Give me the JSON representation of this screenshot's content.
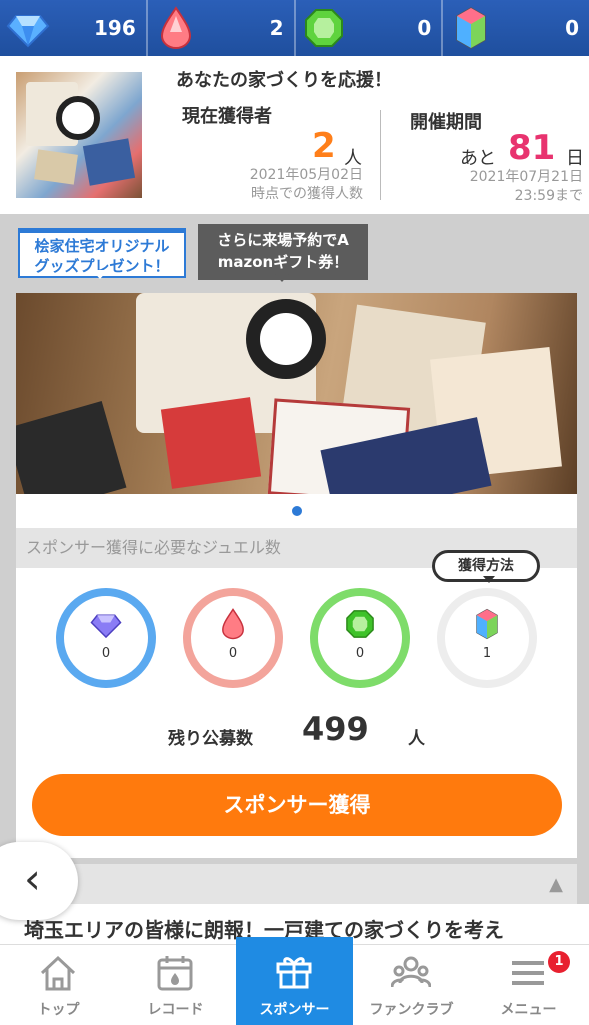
{
  "jewel_bar": {
    "items": [
      {
        "icon": "diamond-icon",
        "count": "196"
      },
      {
        "icon": "ruby-drop-icon",
        "count": "2"
      },
      {
        "icon": "emerald-icon",
        "count": "0"
      },
      {
        "icon": "rainbow-gem-icon",
        "count": "0"
      }
    ]
  },
  "header": {
    "title": "あなたの家づくりを応援！",
    "current_label": "現在獲得者",
    "current_count": "2",
    "current_unit": "人",
    "current_note_line1": "2021年05月02日",
    "current_note_line2": "時点での獲得人数",
    "period_label": "開催期間",
    "remaining_prefix": "あと",
    "remaining_days": "81",
    "remaining_unit": "日",
    "period_end_line1": "2021年07月21日",
    "period_end_line2": "23:59まで"
  },
  "campaign": {
    "tag1_line1": "桧家住宅オリジナル",
    "tag1_line2": "グッズプレゼント！",
    "tag2_line1": "さらに来場予約でA",
    "tag2_line2": "mazonギフト券！"
  },
  "jewel_requirements": {
    "heading": "スポンサー獲得に必要なジュエル数",
    "howto_label": "獲得方法",
    "items": [
      {
        "icon": "diamond-icon",
        "value": "0",
        "color": "#5aa9f0"
      },
      {
        "icon": "ruby-drop-icon",
        "value": "0",
        "color": "#f3a49b"
      },
      {
        "icon": "emerald-icon",
        "value": "0",
        "color": "#7edc6a"
      },
      {
        "icon": "rainbow-gem-icon",
        "value": "1",
        "color": "#ededed"
      }
    ],
    "remaining_label": "残り公募数",
    "remaining_count": "499",
    "remaining_unit": "人",
    "cta_label": "スポンサー獲得",
    "cta_color": "#ff7a0d"
  },
  "news": {
    "headline": "埼玉エリアの皆様に朗報！一戸建ての家づくりを考え"
  },
  "bottom_nav": {
    "items": [
      {
        "label": "トップ",
        "icon": "home-icon"
      },
      {
        "label": "レコード",
        "icon": "calendar-icon"
      },
      {
        "label": "スポンサー",
        "icon": "gift-icon",
        "active": true
      },
      {
        "label": "ファンクラブ",
        "icon": "people-icon"
      },
      {
        "label": "メニュー",
        "icon": "menu-icon",
        "badge": "1"
      }
    ],
    "accent": "#1f8be3"
  }
}
